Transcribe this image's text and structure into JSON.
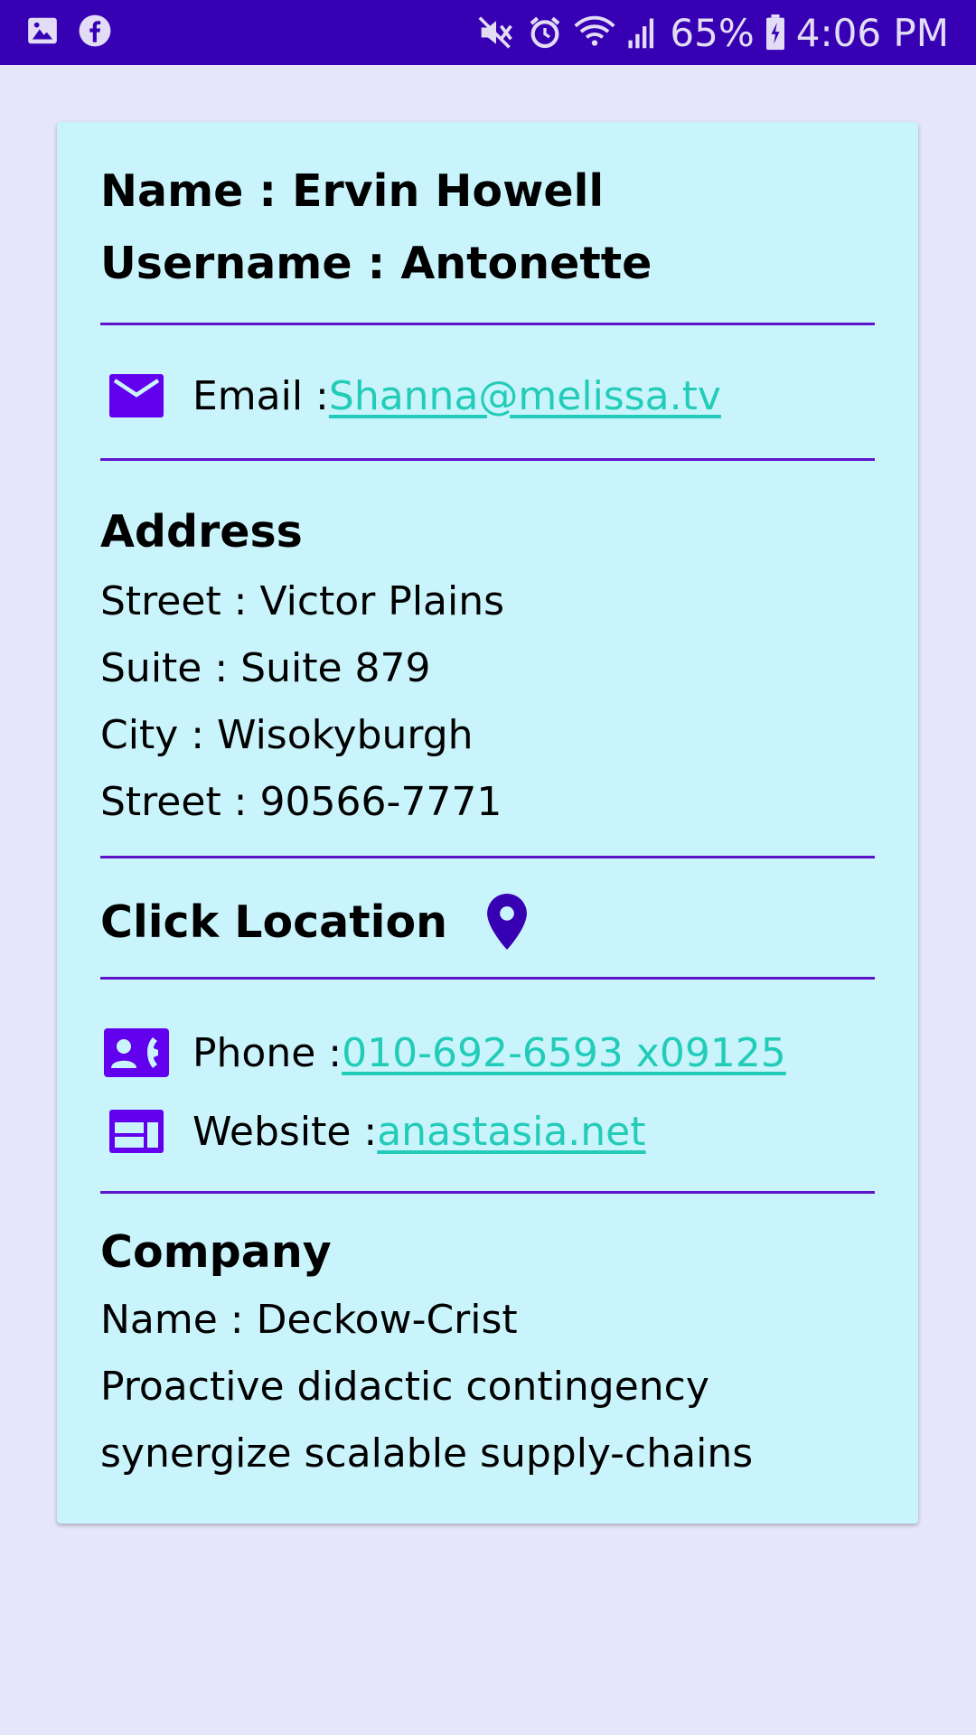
{
  "status_bar": {
    "battery": "65%",
    "time": "4:06 PM",
    "left_icons": [
      "gallery-icon",
      "facebook-icon"
    ],
    "right_icons": [
      "mute-icon",
      "alarm-icon",
      "wifi-icon",
      "signal-icon",
      "battery-charging-icon"
    ]
  },
  "profile": {
    "name_label": "Name : ",
    "name": "Ervin Howell",
    "username_label": "Username : ",
    "username": "Antonette"
  },
  "email": {
    "label": "Email : ",
    "value": "Shanna@melissa.tv",
    "icon": "mail-icon"
  },
  "address": {
    "heading": "Address",
    "street": "Street : Victor Plains",
    "suite": "Suite : Suite 879",
    "city": "City : Wisokyburgh",
    "zip": "Street : 90566-7771"
  },
  "location": {
    "label": "Click Location",
    "icon": "location-pin-icon"
  },
  "contact": {
    "phone_label": "Phone : ",
    "phone": "010-692-6593 x09125",
    "website_label": "Website : ",
    "website": "anastasia.net"
  },
  "company": {
    "heading": "Company",
    "name": "Name : Deckow-Crist",
    "catch_line1": "Proactive didactic contingency",
    "catch_line2": "synergize scalable supply-chains"
  },
  "colors": {
    "status_bar": "#3700b3",
    "background": "#e6e6fa",
    "card": "#caf4fb",
    "accent": "#5d13c9",
    "link": "#22ccb8"
  }
}
